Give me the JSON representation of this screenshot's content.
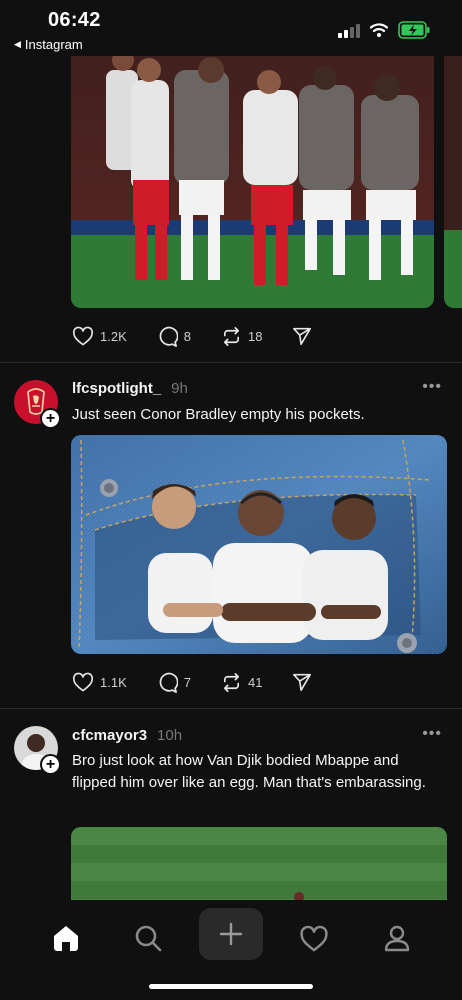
{
  "status_bar": {
    "time": "06:42",
    "back_app": "Instagram"
  },
  "posts": [
    {
      "media_icon": "football-players-photo",
      "stats": {
        "likes": "1.2K",
        "comments": "8",
        "reposts": "18"
      }
    },
    {
      "username": "lfcspotlight_",
      "time": "9h",
      "caption": "Just seen Conor Bradley empty his pockets.",
      "media_icon": "players-in-jeans-pocket-image",
      "stats": {
        "likes": "1.1K",
        "comments": "7",
        "reposts": "41"
      }
    },
    {
      "username": "cfcmayor3",
      "time": "10h",
      "caption": "Bro just look at how Van Djik bodied Mbappe and flipped him over like an egg. Man that's embarassing.",
      "media_icon": "football-pitch-photo"
    }
  ],
  "nav": {
    "items": [
      "home-icon",
      "search-icon",
      "add-icon",
      "heart-icon",
      "profile-icon"
    ],
    "active": "home"
  },
  "colors": {
    "background": "#101010",
    "text": "#f3f5f7",
    "muted": "#777777",
    "battery": "#34c759"
  }
}
